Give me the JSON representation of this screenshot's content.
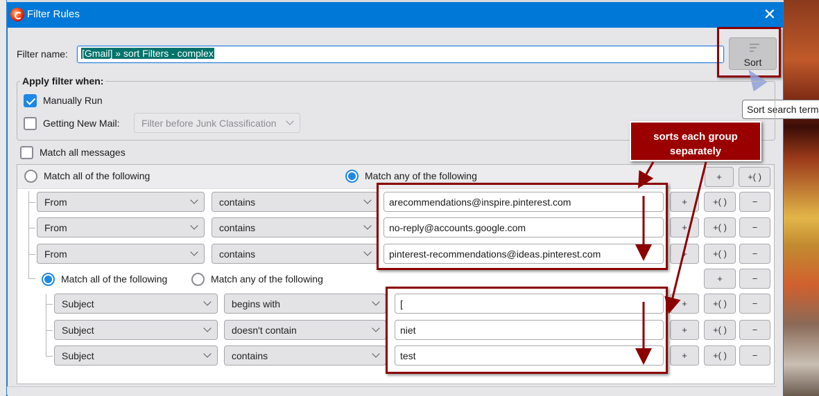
{
  "window": {
    "title": "Filter Rules",
    "close_icon": "close-icon",
    "app_icon": "thunderbird-betterbird-icon"
  },
  "filter_name": {
    "label": "Filter name:",
    "value": "[Gmail] » sort Filters - complex"
  },
  "sort_button": {
    "label": "Sort",
    "icon": "sort-lines-icon",
    "tooltip": "Sort search term"
  },
  "apply_filter": {
    "legend": "Apply filter when:",
    "manually_run": {
      "label": "Manually Run",
      "checked": true
    },
    "getting_new_mail": {
      "label": "Getting New Mail:",
      "checked": false,
      "select_value": "Filter before Junk Classification",
      "disabled": true
    }
  },
  "match_all_messages": {
    "label": "Match all messages",
    "checked": false
  },
  "top_group": {
    "radio_all_label": "Match all of the following",
    "radio_any_label": "Match any of the following",
    "selected": "any",
    "buttons": {
      "add": "+",
      "add_group": "+( )"
    },
    "rules": [
      {
        "field": "From",
        "operator": "contains",
        "value": "arecommendations@inspire.pinterest.com"
      },
      {
        "field": "From",
        "operator": "contains",
        "value": "no-reply@accounts.google.com"
      },
      {
        "field": "From",
        "operator": "contains",
        "value": "pinterest-recommendations@ideas.pinterest.com"
      }
    ]
  },
  "sub_group": {
    "radio_all_label": "Match all of the following",
    "radio_any_label": "Match any of the following",
    "selected": "all",
    "buttons": {
      "add": "+",
      "remove": "−"
    },
    "rules": [
      {
        "field": "Subject",
        "operator": "begins with",
        "value": "["
      },
      {
        "field": "Subject",
        "operator": "doesn't contain",
        "value": "niet"
      },
      {
        "field": "Subject",
        "operator": "contains",
        "value": "test"
      }
    ]
  },
  "row_buttons": {
    "add": "+",
    "add_group": "+( )",
    "remove": "−"
  },
  "annotation": {
    "callout_text": "sorts each group separately",
    "color": "#9a0000"
  }
}
